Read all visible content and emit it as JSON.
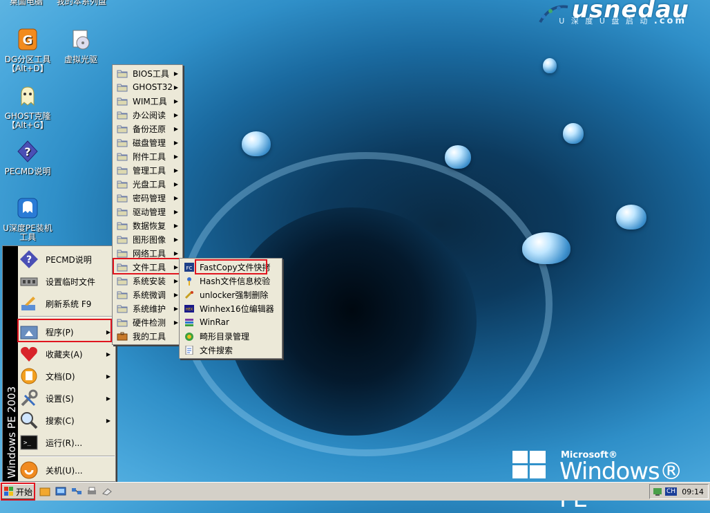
{
  "top_cut": {
    "left": "桌面电脑",
    "right": "我的本系列盘"
  },
  "logo": {
    "text": "usnedau",
    "sub": "U 深 度 U 盘 启 动",
    "dotcom": ".com"
  },
  "desktop_icons": [
    {
      "label_line1": "DG分区工具",
      "label_line2": "【Alt+D】"
    },
    {
      "label_line1": "虚拟光驱",
      "label_line2": ""
    },
    {
      "label_line1": "GHOST克隆",
      "label_line2": "【Alt+G】"
    },
    {
      "label_line1": "PECMD说明",
      "label_line2": ""
    },
    {
      "label_line1": "U深度PE装机",
      "label_line2": "工具"
    }
  ],
  "start_menu": {
    "sidebar_text": "Windows PE 2003",
    "items": [
      {
        "label": "PECMD说明"
      },
      {
        "label": "设置临时文件"
      },
      {
        "label": "刷新系统 F9"
      },
      {
        "label": "程序(P)"
      },
      {
        "label": "收藏夹(A)"
      },
      {
        "label": "文档(D)"
      },
      {
        "label": "设置(S)"
      },
      {
        "label": "搜索(C)"
      },
      {
        "label": "运行(R)..."
      },
      {
        "label": "关机(U)..."
      }
    ]
  },
  "programs_menu": [
    {
      "label": "BIOS工具"
    },
    {
      "label": "GHOST32"
    },
    {
      "label": "WIM工具"
    },
    {
      "label": "办公阅读"
    },
    {
      "label": "备份还原"
    },
    {
      "label": "磁盘管理"
    },
    {
      "label": "附件工具"
    },
    {
      "label": "管理工具"
    },
    {
      "label": "光盘工具"
    },
    {
      "label": "密码管理"
    },
    {
      "label": "驱动管理"
    },
    {
      "label": "数据恢复"
    },
    {
      "label": "图形图像"
    },
    {
      "label": "网络工具"
    },
    {
      "label": "文件工具"
    },
    {
      "label": "系统安装"
    },
    {
      "label": "系统微调"
    },
    {
      "label": "系统维护"
    },
    {
      "label": "硬件检测"
    },
    {
      "label": "我的工具"
    }
  ],
  "file_tools_menu": [
    {
      "label": "FastCopy文件快拷"
    },
    {
      "label": "Hash文件信息校验"
    },
    {
      "label": "unlocker强制删除"
    },
    {
      "label": "Winhex16位编辑器"
    },
    {
      "label": "WinRar"
    },
    {
      "label": "畸形目录管理"
    },
    {
      "label": "文件搜索"
    }
  ],
  "taskbar": {
    "start_label": "开始",
    "tray_lang": "CH",
    "clock": "09:14"
  },
  "brand": {
    "ms": "Microsoft®",
    "name": "Windows® PE"
  },
  "colors": {
    "highlight_red": "#e0141e",
    "menu_bg": "#ece9d8",
    "select_blue": "#3168c6"
  }
}
